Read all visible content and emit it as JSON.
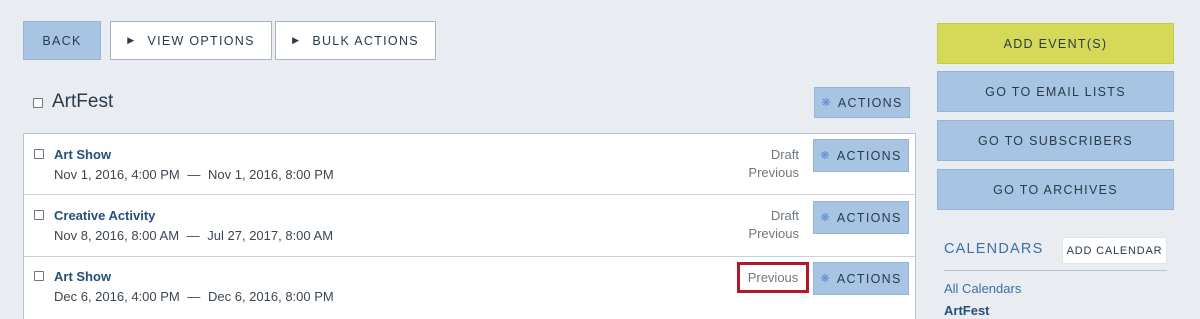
{
  "toolbar": {
    "back_label": "BACK",
    "view_options_label": "VIEW OPTIONS",
    "bulk_actions_label": "BULK ACTIONS"
  },
  "calendar": {
    "title": "ArtFest",
    "actions_label": "ACTIONS"
  },
  "events": [
    {
      "title": "Art Show",
      "start": "Nov 1, 2016, 4:00 PM",
      "separator": "—",
      "end": "Nov 1, 2016, 8:00 PM",
      "status_primary": "Draft",
      "status_secondary": "Previous",
      "actions_label": "ACTIONS"
    },
    {
      "title": "Creative Activity",
      "start": "Nov 8, 2016, 8:00 AM",
      "separator": "—",
      "end": "Jul 27, 2017, 8:00 AM",
      "status_primary": "Draft",
      "status_secondary": "Previous",
      "actions_label": "ACTIONS"
    },
    {
      "title": "Art Show",
      "start": "Dec 6, 2016, 4:00 PM",
      "separator": "—",
      "end": "Dec 6, 2016, 8:00 PM",
      "status_primary": "Previous",
      "actions_label": "ACTIONS"
    }
  ],
  "sidebar": {
    "add_events_label": "ADD EVENT(S)",
    "email_lists_label": "GO TO EMAIL LISTS",
    "subscribers_label": "GO TO SUBSCRIBERS",
    "archives_label": "GO TO ARCHIVES",
    "calendars_heading": "CALENDARS",
    "add_calendar_label": "ADD CALENDAR",
    "calendar_links": [
      "All Calendars",
      "ArtFest"
    ]
  },
  "colors": {
    "background": "#e9edf1",
    "button_blue": "#a7c4e3",
    "button_yellow": "#d5d957",
    "link_blue": "#24507c",
    "highlight_red": "#b3172b"
  },
  "icons": {
    "view_options": "play-triangle-icon",
    "bulk_actions": "play-triangle-icon",
    "actions": "gear-icon"
  }
}
